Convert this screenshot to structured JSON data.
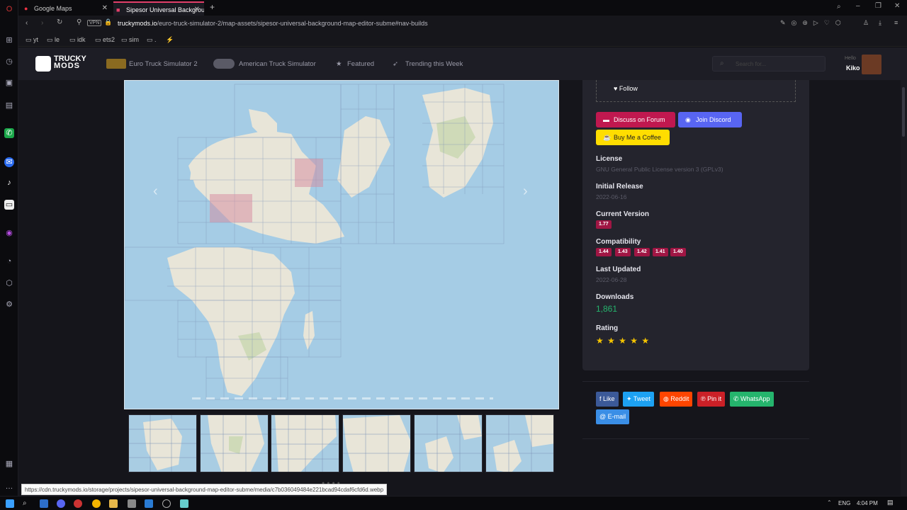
{
  "browser": {
    "tabs": [
      {
        "title": "Google Maps"
      },
      {
        "title": "Sipesor Universal Backgrou"
      }
    ],
    "new_tab_label": "+",
    "url": {
      "domain": "truckymods.io",
      "path": "/euro-truck-simulator-2/map-assets/sipesor-universal-background-map-editor-subme#nav-builds",
      "vpn_label": "VPN"
    },
    "bookmarks": [
      "yt",
      "le",
      "idk",
      "ets2",
      "sim",
      "."
    ],
    "status_url": "https://cdn.truckymods.io/storage/projects/sipesor-universal-background-map-editor-subme/media/c7b036049484e221bcad94cdaf6cfd6d.webp"
  },
  "site": {
    "logo_line1": "TRUCKY",
    "logo_line2": "MODS",
    "nav": {
      "ets2": "Euro Truck Simulator 2",
      "ats": "American Truck Simulator",
      "featured": "Featured",
      "trending": "Trending this Week"
    },
    "search_placeholder": "Search for...",
    "user": {
      "greeting": "Hello",
      "name": "Kiko"
    }
  },
  "gallery": {
    "prev_arrow": "‹",
    "next_arrow": "›",
    "thumbnail_count": 6
  },
  "mod_info": {
    "follow_label": "Follow",
    "discuss_label": "Discuss on Forum",
    "discord_label": "Join Discord",
    "coffee_label": "Buy Me a Coffee",
    "license_label": "License",
    "license_value": "GNU General Public License version 3 (GPLv3)",
    "initial_release_label": "Initial Release",
    "initial_release_value": "2022-06-16",
    "current_version_label": "Current Version",
    "current_version_value": "1.77",
    "compatibility_label": "Compatibility",
    "compatibility": [
      "1.44",
      "1.43",
      "1.42",
      "1.41",
      "1.40"
    ],
    "last_updated_label": "Last Updated",
    "last_updated_value": "2022-06-28",
    "downloads_label": "Downloads",
    "downloads_value": "1,861",
    "rating_label": "Rating",
    "rating_stars": "★ ★ ★ ★ ★"
  },
  "share": {
    "like": "Like",
    "tweet": "Tweet",
    "reddit": "Reddit",
    "pin": "Pin it",
    "whatsapp": "WhatsApp",
    "email": "E-mail"
  },
  "taskbar": {
    "language": "ENG",
    "time": "4:04 PM"
  },
  "colors": {
    "accent_pink": "#c0184f",
    "discord": "#5865f2",
    "coffee": "#ffdd00",
    "downloads_green": "#25b46d",
    "star": "#f5c400"
  }
}
